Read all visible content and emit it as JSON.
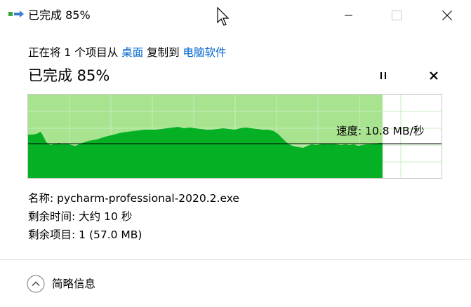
{
  "window": {
    "title": "已完成 85%",
    "app_icon": "file-copy-icon"
  },
  "titlebar": {
    "minimize_icon": "minimize-icon",
    "maximize_icon": "maximize-icon",
    "close_icon": "close-icon"
  },
  "operation": {
    "prefix": "正在将 1 个项目从 ",
    "source": "桌面",
    "middle": " 复制到 ",
    "destination": "电脑软件"
  },
  "progress": {
    "heading": "已完成 85%",
    "percent": 85,
    "pause_icon": "pause-icon",
    "cancel_icon": "close-icon"
  },
  "speed": {
    "label": "速度: 10.8 MB/秒"
  },
  "colors": {
    "graph_fill": "#06b025",
    "graph_progress_bg": "#a8e38f",
    "grid": "#c8eec0",
    "link": "#0066cc"
  },
  "details": {
    "name_row": "名称: pycharm-professional-2020.2.exe",
    "time_row": "剩余时间: 大约 10 秒",
    "items_row": "剩余项目: 1 (57.0 MB)"
  },
  "footer": {
    "toggle_label": "简略信息",
    "toggle_icon": "chevron-up-icon"
  }
}
